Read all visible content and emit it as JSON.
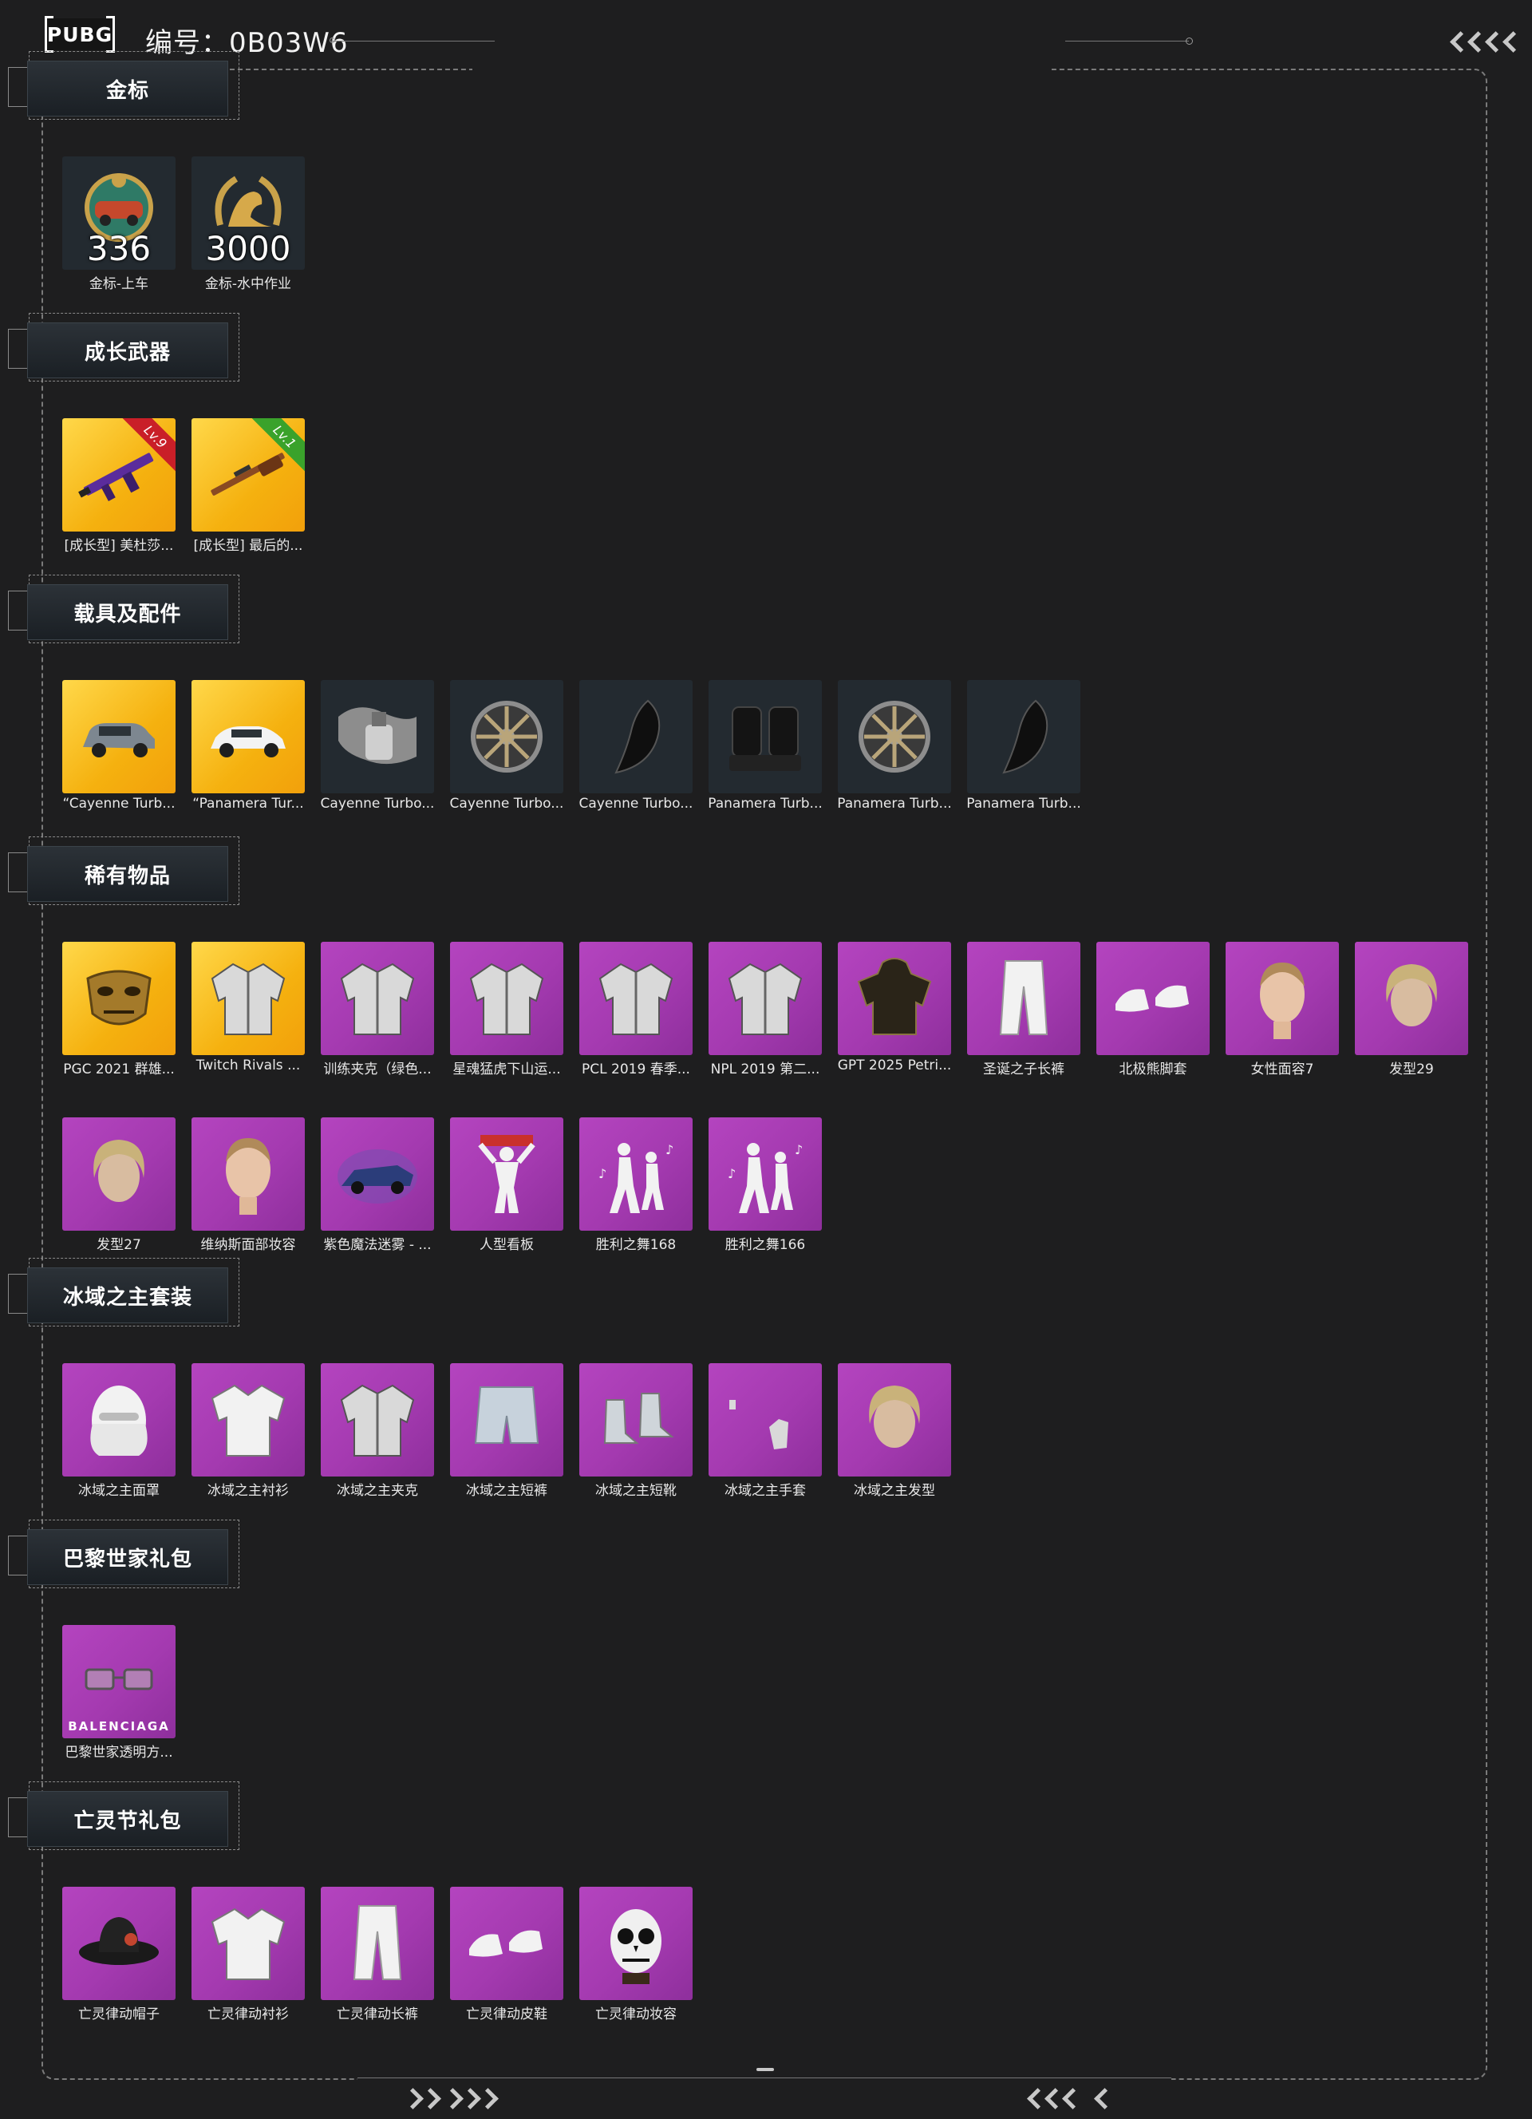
{
  "header": {
    "logo_text": "PUBG",
    "id_label": "编号：0B03W6"
  },
  "sections": [
    {
      "title": "金标",
      "items": [
        {
          "label": "金标-上车",
          "icon": "gold-badge-car-icon",
          "bg": "dark",
          "count": "336"
        },
        {
          "label": "金标-水中作业",
          "icon": "gold-badge-seal-icon",
          "bg": "dark",
          "count": "3000"
        }
      ]
    },
    {
      "title": "成长武器",
      "items": [
        {
          "label": "[成长型] 美杜莎...",
          "icon": "assault-rifle-icon",
          "bg": "gold",
          "level": "Lv.9",
          "level_color": "#c91f28"
        },
        {
          "label": "[成长型] 最后的...",
          "icon": "rifle-icon",
          "bg": "gold",
          "level": "Lv.1",
          "level_color": "#3aa22b"
        }
      ]
    },
    {
      "title": "载具及配件",
      "items": [
        {
          "label": "“Cayenne Turb...",
          "icon": "suv-car-icon",
          "bg": "gold"
        },
        {
          "label": "“Panamera Tur...",
          "icon": "sedan-car-icon",
          "bg": "gold"
        },
        {
          "label": "Cayenne Turbo...",
          "icon": "paint-spray-icon",
          "bg": "dark"
        },
        {
          "label": "Cayenne Turbo...",
          "icon": "wheel-rim-icon",
          "bg": "dark"
        },
        {
          "label": "Cayenne Turbo...",
          "icon": "car-part-icon",
          "bg": "dark"
        },
        {
          "label": "Panamera Turb...",
          "icon": "car-seat-icon",
          "bg": "dark"
        },
        {
          "label": "Panamera Turb...",
          "icon": "wheel-rim-icon",
          "bg": "dark"
        },
        {
          "label": "Panamera Turb...",
          "icon": "car-part-icon",
          "bg": "dark"
        }
      ]
    },
    {
      "title": "稀有物品",
      "items": [
        {
          "label": "PGC 2021 群雄...",
          "icon": "mask-icon",
          "bg": "gold"
        },
        {
          "label": "Twitch Rivals ...",
          "icon": "jacket-icon",
          "bg": "gold"
        },
        {
          "label": "训练夹克（绿色...",
          "icon": "jacket-icon",
          "bg": "purple"
        },
        {
          "label": "星魂猛虎下山运...",
          "icon": "jacket-icon",
          "bg": "purple"
        },
        {
          "label": "PCL 2019 春季...",
          "icon": "jacket-icon",
          "bg": "purple"
        },
        {
          "label": "NPL 2019 第二...",
          "icon": "jacket-icon",
          "bg": "purple"
        },
        {
          "label": "GPT 2025 Petri...",
          "icon": "hoodie-icon",
          "bg": "purple"
        },
        {
          "label": "圣诞之子长裤",
          "icon": "pants-icon",
          "bg": "purple"
        },
        {
          "label": "北极熊脚套",
          "icon": "shoes-icon",
          "bg": "purple"
        },
        {
          "label": "女性面容7",
          "icon": "face-icon",
          "bg": "purple"
        },
        {
          "label": "发型29",
          "icon": "hairstyle-icon",
          "bg": "purple"
        },
        {
          "label": "发型27",
          "icon": "hairstyle-icon",
          "bg": "purple"
        },
        {
          "label": "维纳斯面部妆容",
          "icon": "face-icon",
          "bg": "purple"
        },
        {
          "label": "紫色魔法迷雾 - ...",
          "icon": "purple-car-icon",
          "bg": "purple"
        },
        {
          "label": "人型看板",
          "icon": "figure-sign-icon",
          "bg": "purple"
        },
        {
          "label": "胜利之舞168",
          "icon": "dance-icon",
          "bg": "purple"
        },
        {
          "label": "胜利之舞166",
          "icon": "dance-icon",
          "bg": "purple"
        }
      ]
    },
    {
      "title": "冰域之主套装",
      "items": [
        {
          "label": "冰域之主面罩",
          "icon": "face-mask-icon",
          "bg": "purple"
        },
        {
          "label": "冰域之主衬衫",
          "icon": "shirt-icon",
          "bg": "purple"
        },
        {
          "label": "冰域之主夹克",
          "icon": "jacket-icon",
          "bg": "purple"
        },
        {
          "label": "冰域之主短裤",
          "icon": "shorts-icon",
          "bg": "purple"
        },
        {
          "label": "冰域之主短靴",
          "icon": "boots-icon",
          "bg": "purple"
        },
        {
          "label": "冰域之主手套",
          "icon": "gloves-icon",
          "bg": "purple"
        },
        {
          "label": "冰域之主发型",
          "icon": "hairstyle-icon",
          "bg": "purple"
        }
      ]
    },
    {
      "title": "巴黎世家礼包",
      "items": [
        {
          "label": "巴黎世家透明方...",
          "icon": "glasses-icon",
          "bg": "purple",
          "brand": "BALENCIAGA"
        }
      ]
    },
    {
      "title": "亡灵节礼包",
      "items": [
        {
          "label": "亡灵律动帽子",
          "icon": "hat-icon",
          "bg": "purple"
        },
        {
          "label": "亡灵律动衬衫",
          "icon": "shirt-icon",
          "bg": "purple"
        },
        {
          "label": "亡灵律动长裤",
          "icon": "pants-icon",
          "bg": "purple"
        },
        {
          "label": "亡灵律动皮鞋",
          "icon": "shoes-icon",
          "bg": "purple"
        },
        {
          "label": "亡灵律动妆容",
          "icon": "skull-face-icon",
          "bg": "purple"
        }
      ]
    }
  ]
}
